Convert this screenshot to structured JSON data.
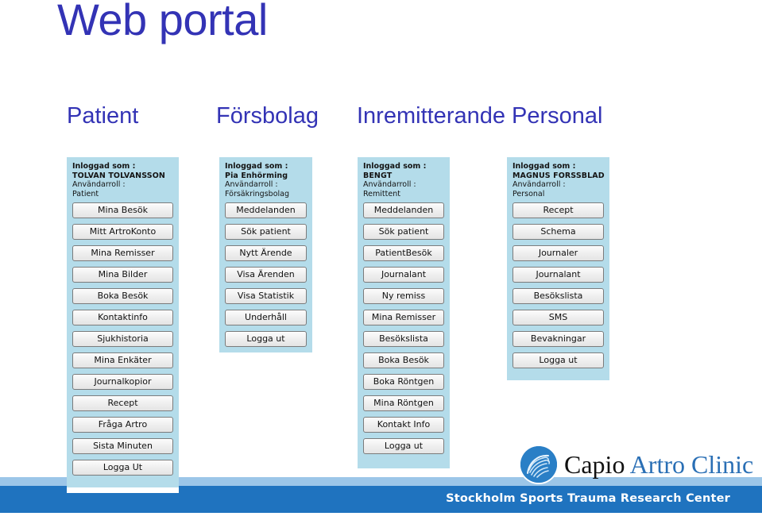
{
  "slide": {
    "title": "Web portal",
    "title_color": "#3333b5",
    "background": "#ffffff"
  },
  "column_headings": [
    {
      "id": "patient",
      "label": "Patient"
    },
    {
      "id": "forsbolag",
      "label": "Försbolag"
    },
    {
      "id": "inremitterande",
      "label": "Inremitterande  Personal"
    }
  ],
  "panels": [
    {
      "id": "patient",
      "panel_color": "#b4dcea",
      "header": {
        "logged_in_label": "Inloggad som :",
        "user_name": "TOLVAN TOLVANSSON",
        "role_label": "Användarroll :",
        "role_value": "Patient"
      },
      "buttons": [
        "Mina Besök",
        "Mitt ArtroKonto",
        "Mina Remisser",
        "Mina Bilder",
        "Boka Besök",
        "Kontaktinfo",
        "Sjukhistoria",
        "Mina Enkäter",
        "Journalkopior",
        "Recept",
        "Fråga Artro",
        "Sista Minuten",
        "Logga Ut"
      ]
    },
    {
      "id": "forsakringsbolag",
      "panel_color": "#b4dcea",
      "header": {
        "logged_in_label": "Inloggad som :",
        "user_name": "Pia Enhörming",
        "role_label": "Användarroll :",
        "role_value": "Försäkringsbolag"
      },
      "buttons": [
        "Meddelanden",
        "Sök patient",
        "Nytt Ärende",
        "Visa Ärenden",
        "Visa Statistik",
        "Underhåll",
        "Logga ut"
      ]
    },
    {
      "id": "remittent",
      "panel_color": "#b4dcea",
      "header": {
        "logged_in_label": "Inloggad som :",
        "user_name": "BENGT",
        "role_label": "Användarroll :",
        "role_value": "Remittent"
      },
      "buttons": [
        "Meddelanden",
        "Sök patient",
        "PatientBesök",
        "Journalant",
        "Ny remiss",
        "Mina Remisser",
        "Besökslista",
        "Boka Besök",
        "Boka Röntgen",
        "Mina Röntgen",
        "Kontakt Info",
        "Logga ut"
      ]
    },
    {
      "id": "personal",
      "panel_color": "#b4dcea",
      "header": {
        "logged_in_label": "Inloggad som :",
        "user_name": "MAGNUS FORSSBLAD",
        "role_label": "Användarroll :",
        "role_value": "Personal"
      },
      "buttons": [
        "Recept",
        "Schema",
        "Journaler",
        "Journalant",
        "Besökslista",
        "SMS",
        "Bevakningar",
        "Logga ut"
      ]
    }
  ],
  "logo": {
    "word_one": "Capio",
    "word_two": " Artro Clinic",
    "mark_color": "#2a7fc6"
  },
  "footer": {
    "text": "Stockholm Sports Trauma Research Center",
    "bar_color": "#1f73bf",
    "strip_color": "#9cc6e8"
  }
}
